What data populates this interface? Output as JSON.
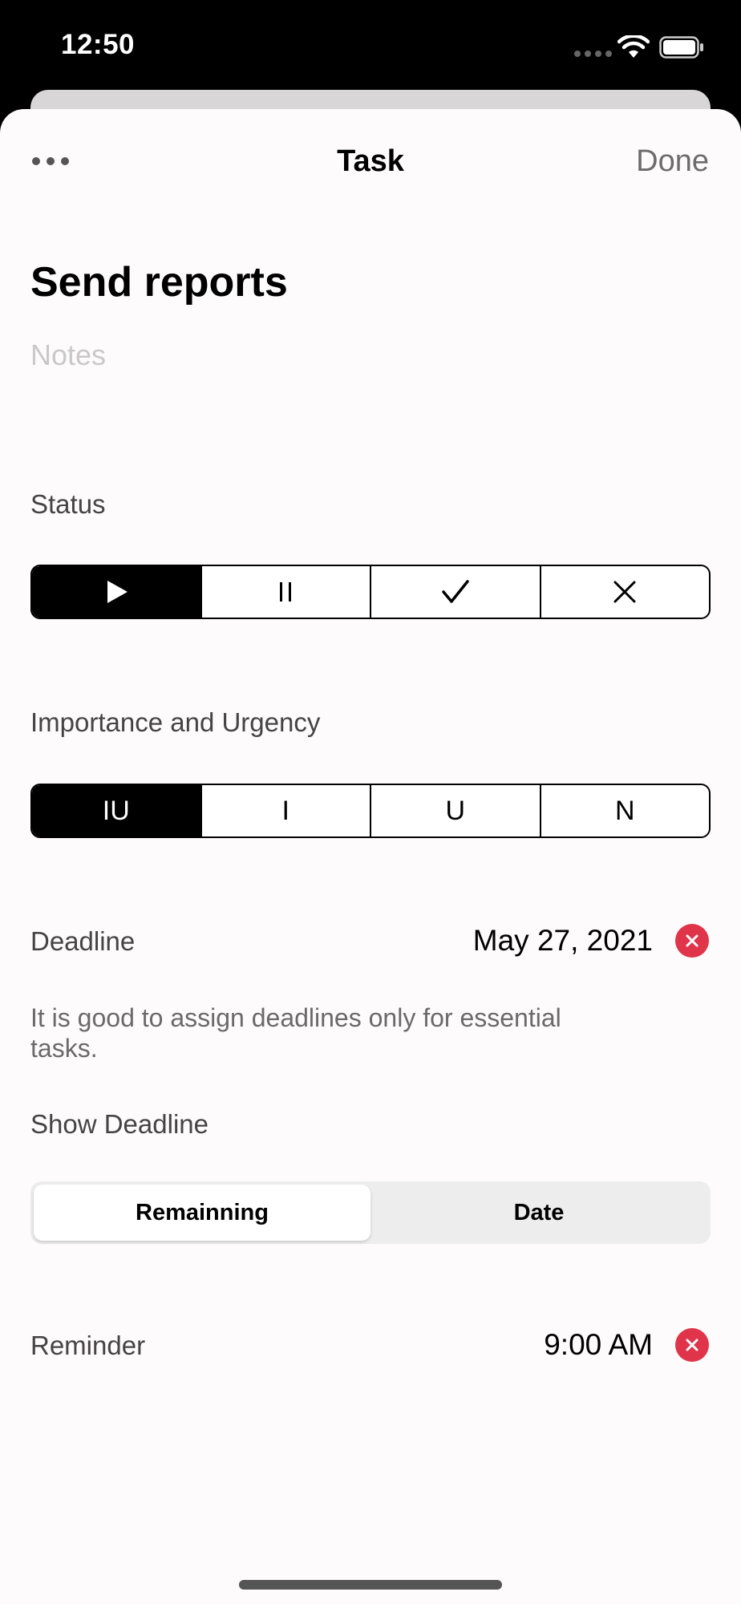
{
  "status_bar": {
    "time": "12:50"
  },
  "nav": {
    "title": "Task",
    "done_label": "Done",
    "more_icon": "ellipsis-icon"
  },
  "task": {
    "title": "Send reports",
    "notes_placeholder": "Notes",
    "notes_value": ""
  },
  "status": {
    "label": "Status",
    "options": [
      {
        "icon": "play-icon",
        "selected": true
      },
      {
        "icon": "pause-icon",
        "selected": false
      },
      {
        "icon": "checkmark-icon",
        "selected": false
      },
      {
        "icon": "xmark-icon",
        "selected": false
      }
    ]
  },
  "importance": {
    "label": "Importance and Urgency",
    "options": [
      {
        "label": "IU",
        "selected": true
      },
      {
        "label": "I",
        "selected": false
      },
      {
        "label": "U",
        "selected": false
      },
      {
        "label": "N",
        "selected": false
      }
    ]
  },
  "deadline": {
    "label": "Deadline",
    "value": "May 27, 2021",
    "hint": "It is good to assign deadlines only for essential tasks."
  },
  "show_deadline": {
    "label": "Show Deadline",
    "options": [
      {
        "label": "Remainning",
        "selected": true
      },
      {
        "label": "Date",
        "selected": false
      }
    ]
  },
  "reminder": {
    "label": "Reminder",
    "value": "9:00 AM"
  },
  "colors": {
    "accent": "#000000",
    "clear": "#e0344a",
    "done": "#6c6c6c",
    "placeholder": "#c9c9c9"
  }
}
